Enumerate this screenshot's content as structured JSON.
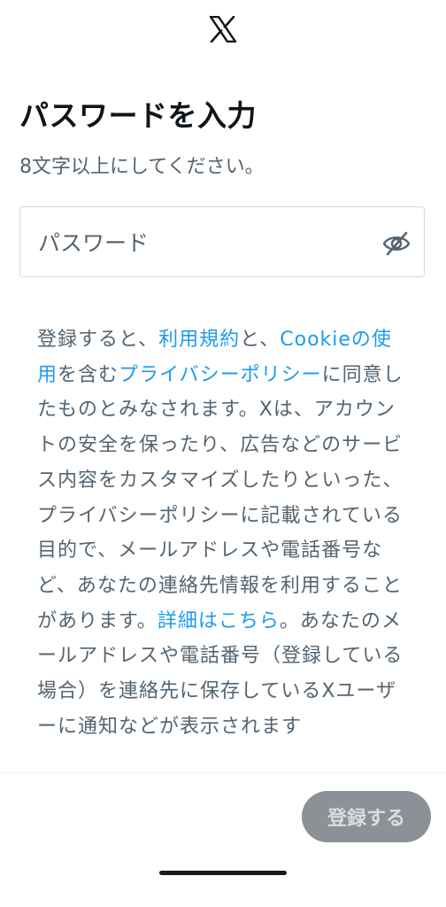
{
  "header": {
    "logo_icon": "x-logo-icon"
  },
  "title": "パスワードを入力",
  "subtitle": "8文字以上にしてください。",
  "password": {
    "placeholder": "パスワード",
    "value": "",
    "visibility_icon": "eye-off-icon"
  },
  "legal": {
    "part1": "登録すると、",
    "terms_link": "利用規約",
    "part2": "と、",
    "cookie_link": "Cookieの使用",
    "part3": "を含む",
    "privacy_link": "プライバシーポリシー",
    "part4": "に同意したものとみなされます。Xは、アカウントの安全を保ったり、広告などのサービス内容をカスタマイズしたりといった、プライバシーポリシーに記載されている目的で、メールアドレスや電話番号など、あなたの連絡先情報を利用することがあります。",
    "details_link": "詳細はこちら",
    "part5": "。あなたのメールアドレスや電話番号（登録している場合）を連絡先に保存しているXユーザーに通知などが表示されます"
  },
  "footer": {
    "signup_label": "登録する"
  },
  "colors": {
    "text": "#0f1419",
    "secondary": "#536471",
    "link": "#1d9bf0",
    "border": "#cfd9de",
    "disabled_button": "#8b9197"
  }
}
